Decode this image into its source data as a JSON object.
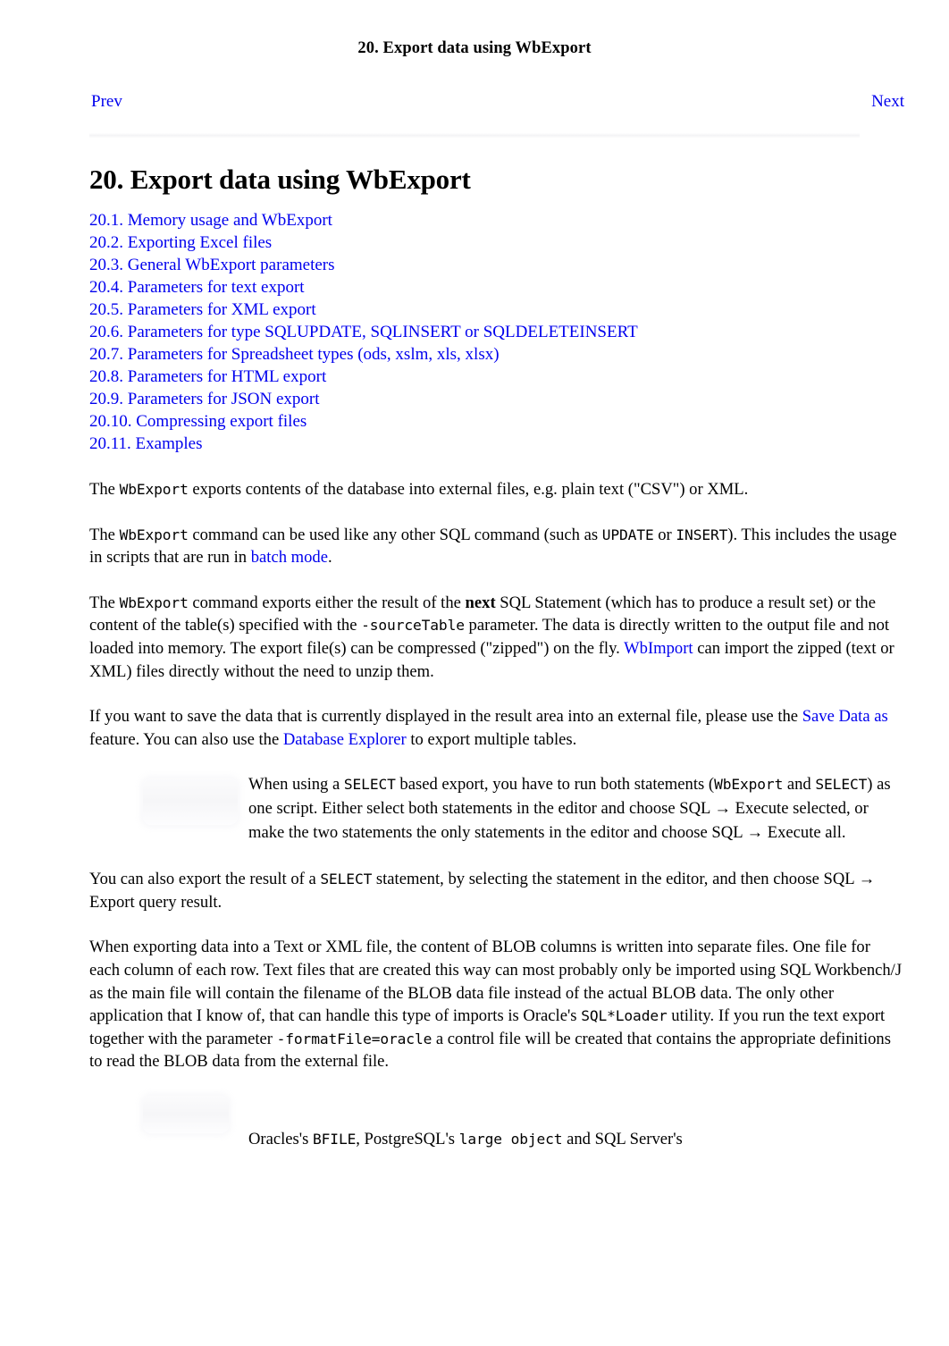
{
  "nav": {
    "title": "20. Export data using WbExport",
    "prev_label": "Prev",
    "next_label": "Next"
  },
  "chapter": {
    "heading": "20. Export data using WbExport"
  },
  "toc": [
    {
      "label": "20.1. Memory usage and WbExport"
    },
    {
      "label": "20.2. Exporting Excel files"
    },
    {
      "label": "20.3. General WbExport parameters"
    },
    {
      "label": "20.4. Parameters for text export"
    },
    {
      "label": "20.5. Parameters for XML export"
    },
    {
      "label": "20.6. Parameters for type SQLUPDATE, SQLINSERT or SQLDELETEINSERT"
    },
    {
      "label": "20.7. Parameters for Spreadsheet types (ods, xslm, xls, xlsx)"
    },
    {
      "label": "20.8. Parameters for HTML export"
    },
    {
      "label": "20.9. Parameters for JSON export"
    },
    {
      "label": "20.10. Compressing export files"
    },
    {
      "label": "20.11. Examples"
    }
  ],
  "paragraphs": {
    "p1": {
      "t1": "The ",
      "code1": "WbExport",
      "t2": " exports contents of the database into external files, e.g. plain text (\"CSV\") or XML."
    },
    "p2": {
      "t1": "The ",
      "code1": "WbExport",
      "t2": " command can be used like any other SQL command (such as ",
      "code2": "UPDATE",
      "t3": " or ",
      "code3": "INSERT",
      "t4": "). This includes the usage in scripts that are run in ",
      "link1": "batch mode",
      "t5": "."
    },
    "p3": {
      "t1": "The ",
      "code1": "WbExport",
      "t2": " command exports either the result of the ",
      "bold1": "next",
      "t3": " SQL Statement (which has to produce a result set) or the content of the table(s) specified with the ",
      "code2": "-sourceTable",
      "t4": " parameter. The data is directly written to the output file and not loaded into memory. The export file(s) can be compressed (\"zipped\") on the fly. ",
      "link1": "WbImport",
      "t5": " can import the zipped (text or XML) files directly without the need to unzip them."
    },
    "p4": {
      "t1": "If you want to save the data that is currently displayed in the result area into an external file, please use the ",
      "link1": "Save Data as",
      "t2": " feature. You can also use the ",
      "link2": "Database Explorer",
      "t3": " to export multiple tables."
    },
    "p5": {
      "t1": "You can also export the result of a ",
      "code1": "SELECT",
      "t2": " statement, by selecting the statement in the editor, and then choose SQL → Export query result."
    },
    "p6": {
      "t1": "When exporting data into a Text or XML file, the content of BLOB columns is written into separate files. One file for each column of each row. Text files that are created this way can most probably only be imported using SQL Workbench/J as the main file will contain the filename of the BLOB data file instead of the actual BLOB data. The only other application that I know of, that can handle this type of imports is Oracle's ",
      "code1": "SQL*Loader",
      "t2": " utility. If you run the text export together with the parameter ",
      "code2": "-formatFile=oracle",
      "t3": " a control file will be created that contains the appropriate definitions to read the BLOB data from the external file."
    }
  },
  "notes": {
    "note1": {
      "icon": "note-icon",
      "t1": "When using a ",
      "code1": "SELECT",
      "t2": " based export, you have to run both statements (",
      "code2": "WbExport",
      "t3": " and ",
      "code3": "SELECT",
      "t4": ") as one script. Either select both statements in the editor and choose SQL → Execute selected, or make the two statements the only statements in the editor and choose SQL → Execute all."
    },
    "note2": {
      "icon": "note-icon",
      "t1": "Oracles's ",
      "code1": "BFILE",
      "t2": ", PostgreSQL's ",
      "code2": "large object",
      "t3": " and SQL Server's"
    }
  },
  "colors": {
    "link": "#0000EE",
    "text": "#000000",
    "background": "#FFFFFF"
  }
}
